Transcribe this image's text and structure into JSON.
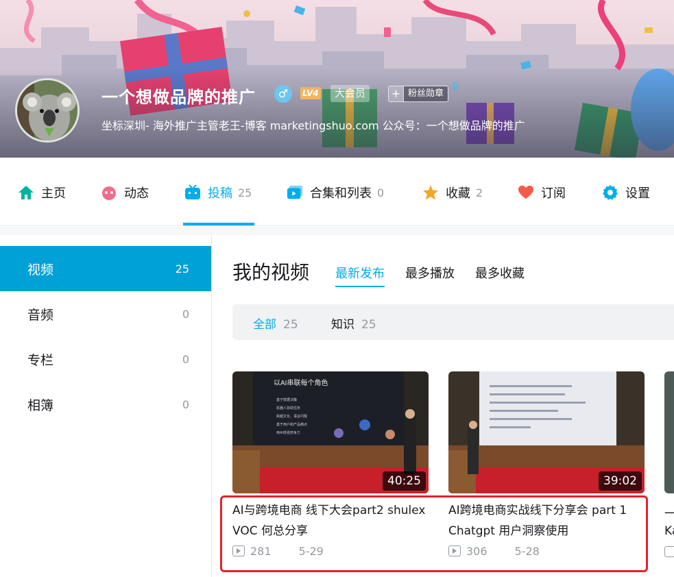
{
  "profile": {
    "username": "一个想做品牌的推广",
    "gender_symbol": "♂",
    "level": "LV4",
    "vip_label": "大会员",
    "fan_badge_plus": "+",
    "fan_badge_label": "粉丝勋章",
    "bio": "坐标深圳- 海外推广主管老王-博客 marketingshuo.com 公众号：一个想做品牌的推广"
  },
  "nav": {
    "items": [
      {
        "label": "主页",
        "count": "",
        "icon": "home-icon",
        "color": "#00b5a0"
      },
      {
        "label": "动态",
        "count": "",
        "icon": "dynamic-icon",
        "color": "#f26d8c"
      },
      {
        "label": "投稿",
        "count": "25",
        "icon": "tv-icon",
        "color": "#00aeec"
      },
      {
        "label": "合集和列表",
        "count": "0",
        "icon": "collection-icon",
        "color": "#00aeec"
      },
      {
        "label": "收藏",
        "count": "2",
        "icon": "star-icon",
        "color": "#f5a623"
      },
      {
        "label": "订阅",
        "count": "",
        "icon": "heart-icon",
        "color": "#f25d4a"
      },
      {
        "label": "设置",
        "count": "",
        "icon": "gear-icon",
        "color": "#00aeec"
      }
    ],
    "active_index": 2
  },
  "sidebar": {
    "items": [
      {
        "label": "视频",
        "count": "25"
      },
      {
        "label": "音频",
        "count": "0"
      },
      {
        "label": "专栏",
        "count": "0"
      },
      {
        "label": "相簿",
        "count": "0"
      }
    ],
    "active_index": 0
  },
  "main": {
    "title": "我的视频",
    "sort_tabs": [
      "最新发布",
      "最多播放",
      "最多收藏"
    ],
    "filters": [
      {
        "label": "全部",
        "count": "25"
      },
      {
        "label": "知识",
        "count": "25"
      }
    ]
  },
  "videos": [
    {
      "title": "AI与跨境电商 线下大会part2 shulex VOC 何总分享",
      "duration": "40:25",
      "plays": "281",
      "date": "5-29",
      "slide_title": "以AI串联每个角色",
      "slide_bullets": [
        "基于数据决策",
        "机器人协助任务",
        "跨越文化、语言问题",
        "基于用户和产品痛点",
        "用AI增强竞争力"
      ]
    },
    {
      "title": "AI跨境电商实战线下分享会 part 1 Chatgpt 用户洞察使用",
      "duration": "39:02",
      "plays": "306",
      "date": "5-28"
    }
  ],
  "partial_video": {
    "line1": "一",
    "line2": "Ka"
  },
  "colors": {
    "accent": "#00aeec",
    "sidebar_active": "#00a1d6",
    "highlight": "#e5212e"
  }
}
